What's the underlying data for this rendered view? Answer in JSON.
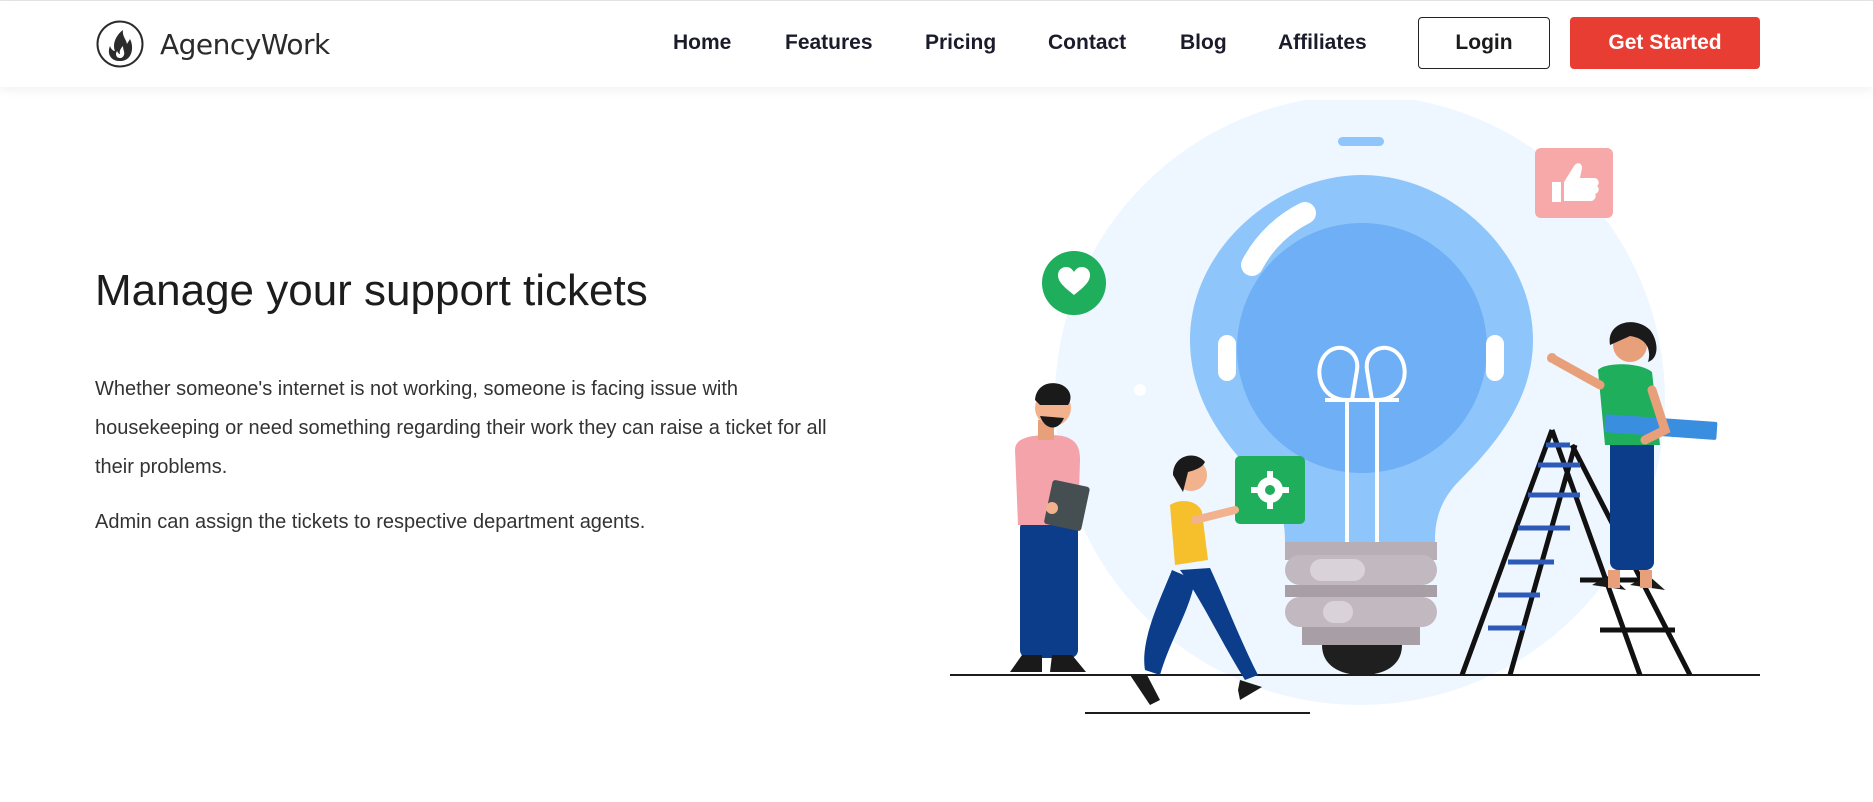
{
  "header": {
    "brand": "AgencyWork",
    "nav": [
      "Home",
      "Features",
      "Pricing",
      "Contact",
      "Blog",
      "Affiliates"
    ],
    "login_label": "Login",
    "cta_label": "Get Started"
  },
  "hero": {
    "title": "Manage your support tickets",
    "paragraph1": "Whether someone's internet is not working, someone is facing issue with housekeeping or need something regarding their work they can raise a ticket for all their problems.",
    "paragraph2": "Admin can assign the tickets to respective department agents."
  },
  "colors": {
    "accent": "#e83d32",
    "bulb_blue": "#8ec5fb",
    "gear_green": "#1fae5b",
    "thumb_pink": "#f7a8a8"
  },
  "icons": [
    "flame-logo-icon",
    "heart-icon",
    "gear-icon",
    "thumbs-up-icon"
  ]
}
